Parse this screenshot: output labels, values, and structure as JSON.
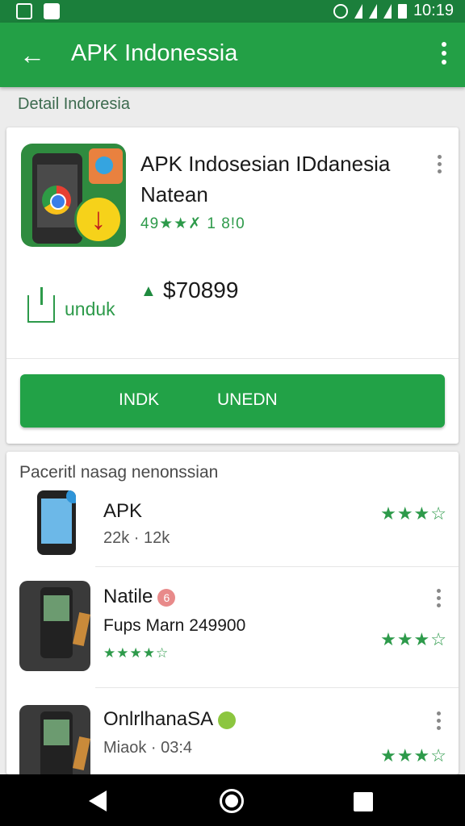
{
  "status_bar": {
    "time": "10:19",
    "icons": [
      "image-icon",
      "check-icon",
      "alarm-icon",
      "wifi-icon",
      "signal-icon",
      "signal-icon",
      "battery-icon"
    ]
  },
  "app_bar": {
    "back_icon": "arrow-left-icon",
    "title": "APK Indonessia",
    "menu_icon": "more-vert-icon"
  },
  "section_label": "Detail Indoresia",
  "detail": {
    "title": "APK Indosesian IDdanesia Natean",
    "rating_text": "49★★✗ 1 8!0",
    "price_icon": "price-tag-icon",
    "price": "$70899",
    "download_icon": "download-icon",
    "download_label": "unduk",
    "button_label_left": "INDK",
    "button_label_right": "UNEDN",
    "accent": "#22a247"
  },
  "list": {
    "header": "Paceritl nasag nenonssian",
    "items": [
      {
        "title": "APK",
        "subtitle": "22k · 12k",
        "rating_stars": "★★★☆"
      },
      {
        "title": "Natile",
        "badge": "6",
        "subtitle": "Fups Marn 249900",
        "small_stars": "★★★★☆",
        "rating_stars": "★★★☆"
      },
      {
        "title": "OnlrlhanaSA",
        "subtitle": "Miaok · 03:4",
        "rating_stars": "★★★☆"
      }
    ]
  },
  "nav_bar": {
    "icons": [
      "nav-back-icon",
      "nav-home-icon",
      "nav-recents-icon"
    ]
  }
}
